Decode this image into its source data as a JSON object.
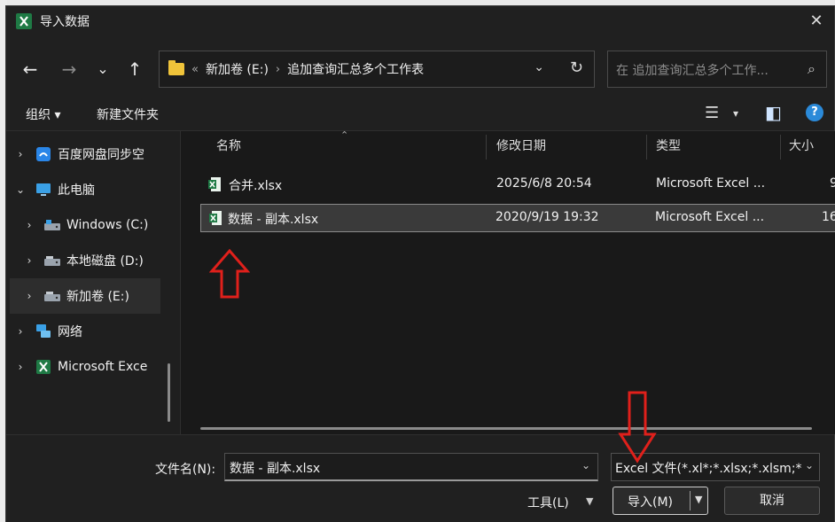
{
  "window": {
    "title": "导入数据",
    "close_glyph": "✕"
  },
  "nav": {
    "back_glyph": "←",
    "forward_glyph": "→",
    "recent_glyph": "⌄",
    "up_glyph": "↑"
  },
  "address": {
    "overflow": "«",
    "segments": [
      "新加卷 (E:)",
      "追加查询汇总多个工作表"
    ],
    "separator": "›",
    "chevron_glyph": "⌄",
    "refresh_glyph": "↻"
  },
  "search": {
    "placeholder": "在 追加查询汇总多个工作...",
    "icon_glyph": "⌕"
  },
  "toolbar": {
    "organize": "组织 ▾",
    "new_folder": "新建文件夹",
    "view_glyph": "☰",
    "view_chev": "▾",
    "preview_glyph": "◧",
    "help_glyph": "?"
  },
  "sidebar": {
    "items": [
      {
        "label": "百度网盘同步空",
        "chevron": "›",
        "icon": "baidu-cloud-icon"
      },
      {
        "label": "此电脑",
        "chevron": "⌄",
        "icon": "computer-icon"
      },
      {
        "label": "Windows (C:)",
        "chevron": "›",
        "icon": "drive-icon"
      },
      {
        "label": "本地磁盘 (D:)",
        "chevron": "›",
        "icon": "drive-icon"
      },
      {
        "label": "新加卷 (E:)",
        "chevron": "›",
        "icon": "drive-icon"
      },
      {
        "label": "网络",
        "chevron": "›",
        "icon": "network-icon"
      },
      {
        "label": "Microsoft Exce",
        "chevron": "›",
        "icon": "excel-icon"
      }
    ]
  },
  "columns": {
    "name": "名称",
    "modified": "修改日期",
    "type": "类型",
    "size": "大小"
  },
  "files": [
    {
      "name": "合并.xlsx",
      "modified": "2025/6/8 20:54",
      "type": "Microsoft Excel ...",
      "size": "9"
    },
    {
      "name": "数据 - 副本.xlsx",
      "modified": "2020/9/19 19:32",
      "type": "Microsoft Excel ...",
      "size": "16"
    }
  ],
  "bottom": {
    "filename_label": "文件名(N):",
    "filename_value": "数据 - 副本.xlsx",
    "filetype_value": "Excel 文件(*.xl*;*.xlsx;*.xlsm;*",
    "tools_label": "工具(L)",
    "import_label": "导入(M)",
    "cancel_label": "取消"
  },
  "colors": {
    "excel_green": "#1f7a45",
    "annotation_red": "#e0201b",
    "help_blue": "#2b8ad9"
  }
}
